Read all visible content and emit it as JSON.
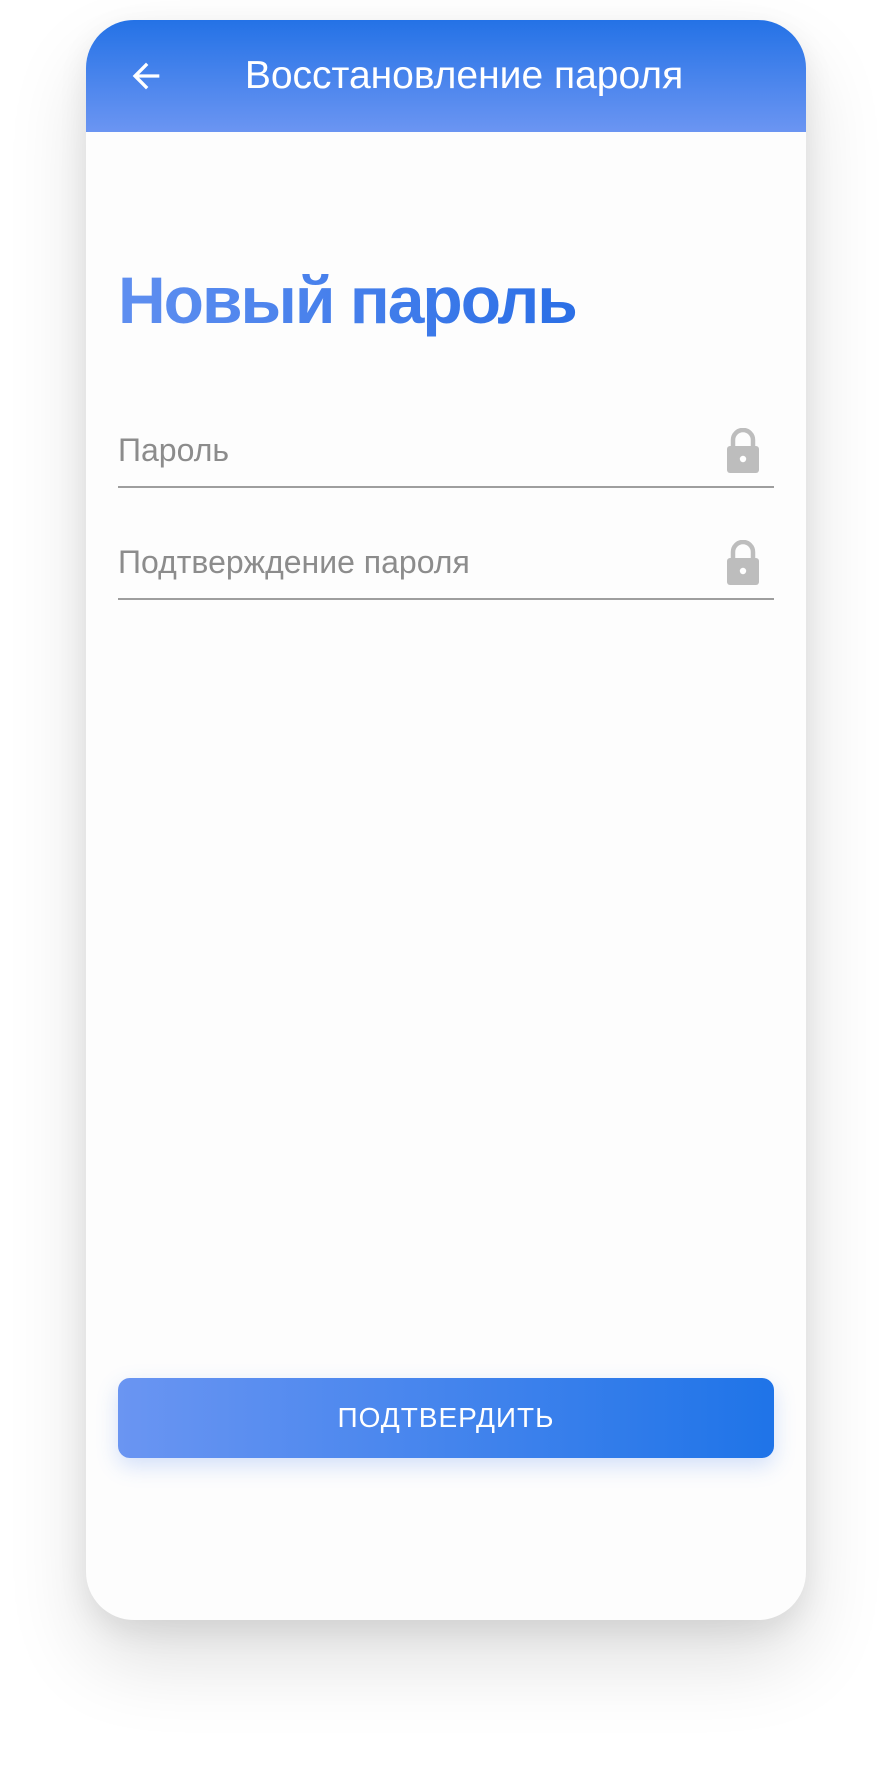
{
  "appbar": {
    "title": "Восстановление пароля",
    "back_icon": "arrow-left-icon"
  },
  "main": {
    "heading": "Новый пароль",
    "fields": [
      {
        "placeholder": "Пароль",
        "value": "",
        "icon": "lock-icon"
      },
      {
        "placeholder": "Подтверждение пароля",
        "value": "",
        "icon": "lock-icon"
      }
    ],
    "confirm_label": "ПОДТВЕРДИТЬ"
  },
  "colors": {
    "appbar_gradient_start": "#2472e6",
    "appbar_gradient_end": "#6b95f2",
    "accent": "#3574e6",
    "icon_gray": "#bdbdbd",
    "underline": "#9e9e9e",
    "placeholder": "#8c8c8c"
  }
}
